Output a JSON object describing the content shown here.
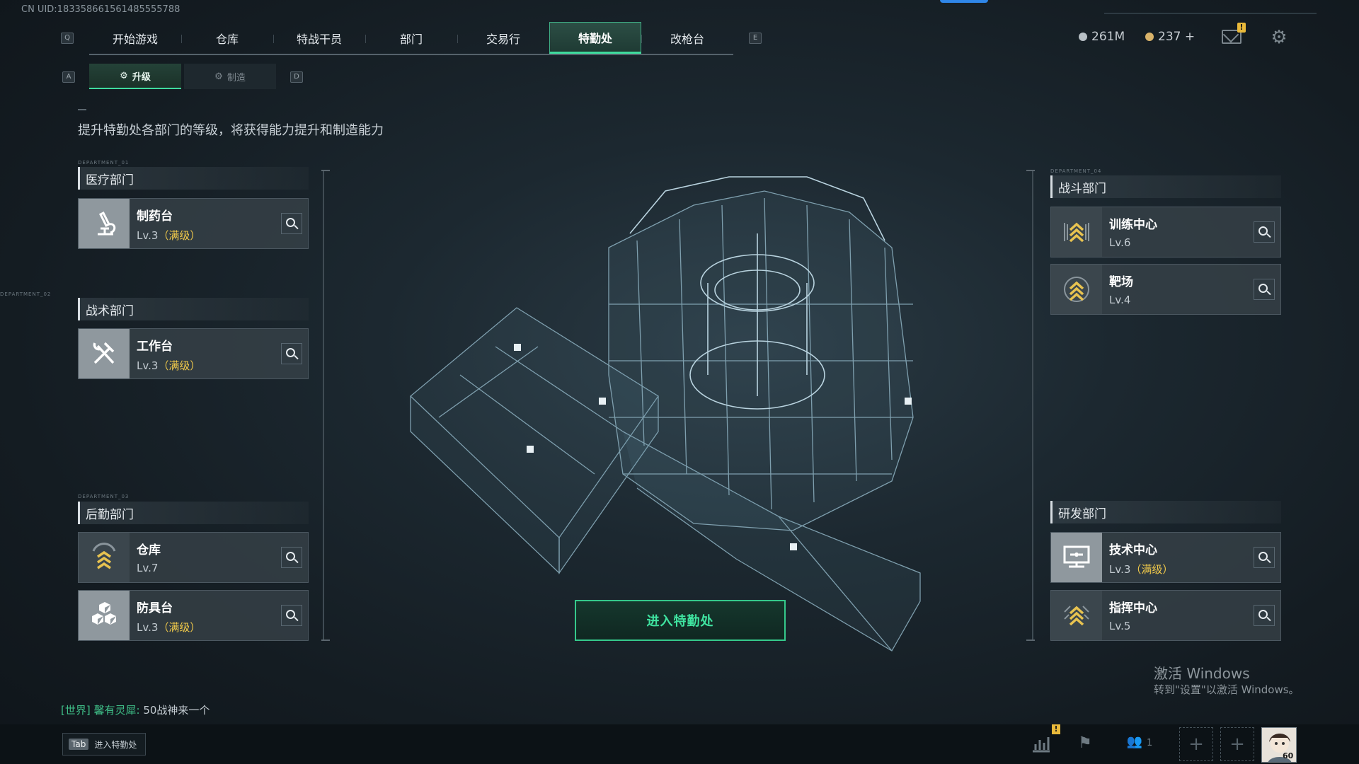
{
  "uid": "CN UID:1833586615614855557​88",
  "nav": {
    "left_key": "Q",
    "right_key": "E",
    "items": [
      {
        "label": "开始游戏"
      },
      {
        "label": "仓库"
      },
      {
        "label": "特战干员"
      },
      {
        "label": "部门"
      },
      {
        "label": "交易行"
      },
      {
        "label": "特勤处",
        "active": true
      },
      {
        "label": "改枪台"
      }
    ]
  },
  "resources": {
    "silver": "261M",
    "gold": "237 +"
  },
  "subtabs": {
    "left_key": "A",
    "right_key": "D",
    "items": [
      {
        "label": "升级",
        "active": true
      },
      {
        "label": "制造",
        "active": false
      }
    ]
  },
  "description": "提升特勤处各部门的等级，将获得能力提升和制造能力",
  "departments": {
    "medical": {
      "tag": "DEPARTMENT_01",
      "title": "医疗部门",
      "facilities": [
        {
          "name": "制药台",
          "level": "Lv.3",
          "max": "（满级）",
          "icon": "microscope-icon"
        }
      ]
    },
    "tactical": {
      "tag": "DEPARTMENT_02",
      "title": "战术部门",
      "facilities": [
        {
          "name": "工作台",
          "level": "Lv.3",
          "max": "（满级）",
          "icon": "hammer-wrench-icon"
        }
      ]
    },
    "logistics": {
      "tag": "DEPARTMENT_03",
      "title": "后勤部门",
      "facilities": [
        {
          "name": "仓库",
          "level": "Lv.7",
          "max": "",
          "icon": "rank-chevron-icon"
        },
        {
          "name": "防具台",
          "level": "Lv.3",
          "max": "（满级）",
          "icon": "cubes-icon"
        }
      ]
    },
    "combat": {
      "tag": "DEPARTMENT_04",
      "title": "战斗部门",
      "facilities": [
        {
          "name": "训练中心",
          "level": "Lv.6",
          "max": "",
          "icon": "rank-chevron-icon"
        },
        {
          "name": "靶场",
          "level": "Lv.4",
          "max": "",
          "icon": "rank-chevron-icon"
        }
      ]
    },
    "research": {
      "title": "研发部门",
      "facilities": [
        {
          "name": "技术中心",
          "level": "Lv.3",
          "max": "（满级）",
          "icon": "computer-icon"
        },
        {
          "name": "指挥中心",
          "level": "Lv.5",
          "max": "",
          "icon": "rank-chevron-icon"
        }
      ]
    }
  },
  "enter_button": "进入特勤处",
  "watermark": {
    "line1": "激活 Windows",
    "line2": "转到\"设置\"以激活 Windows。"
  },
  "chat": {
    "channel": "[世界]",
    "sender": "馨有灵犀:",
    "message": "50战神来一个"
  },
  "bottom": {
    "tab_key": "Tab",
    "tab_label": "进入特勤处",
    "friends_count": "1",
    "avatar_level": "60",
    "badge": "!"
  },
  "colors": {
    "accent": "#3fdc9e",
    "max_level": "#f0c94a",
    "badge": "#e9b93a"
  }
}
